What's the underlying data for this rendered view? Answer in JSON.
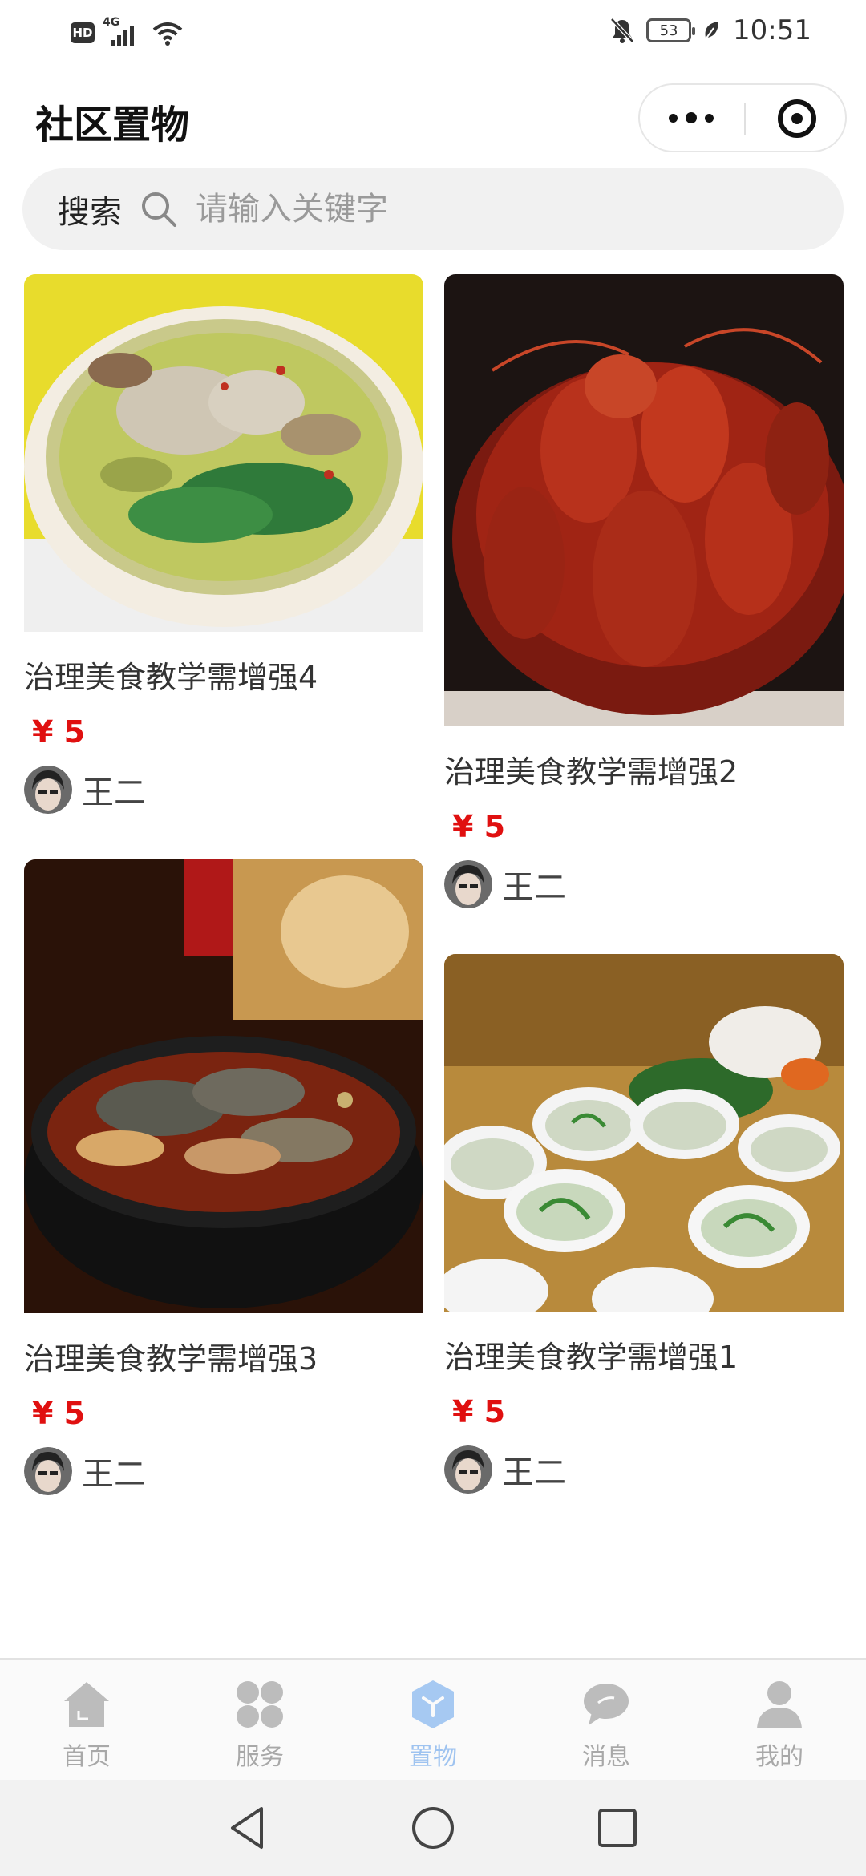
{
  "status_bar": {
    "hd": "HD",
    "network": "4G",
    "battery": "53",
    "time": "10:51"
  },
  "header": {
    "title": "社区置物"
  },
  "search": {
    "label": "搜索",
    "placeholder": "请输入关键字"
  },
  "items": [
    {
      "title": "治理美食教学需增强4",
      "price": "¥ 5",
      "user": "王二"
    },
    {
      "title": "治理美食教学需增强2",
      "price": "¥ 5",
      "user": "王二"
    },
    {
      "title": "治理美食教学需增强3",
      "price": "¥ 5",
      "user": "王二"
    },
    {
      "title": "治理美食教学需增强1",
      "price": "¥ 5",
      "user": "王二"
    }
  ],
  "tabbar": {
    "tabs": [
      {
        "label": "首页",
        "icon": "home-icon"
      },
      {
        "label": "服务",
        "icon": "grid-icon"
      },
      {
        "label": "置物",
        "icon": "cube-icon",
        "active": true
      },
      {
        "label": "消息",
        "icon": "chat-icon"
      },
      {
        "label": "我的",
        "icon": "person-icon"
      }
    ]
  },
  "colors": {
    "price": "#e01010",
    "active_tab": "#9ec3f0",
    "inactive_tab": "#a8a8a8"
  }
}
